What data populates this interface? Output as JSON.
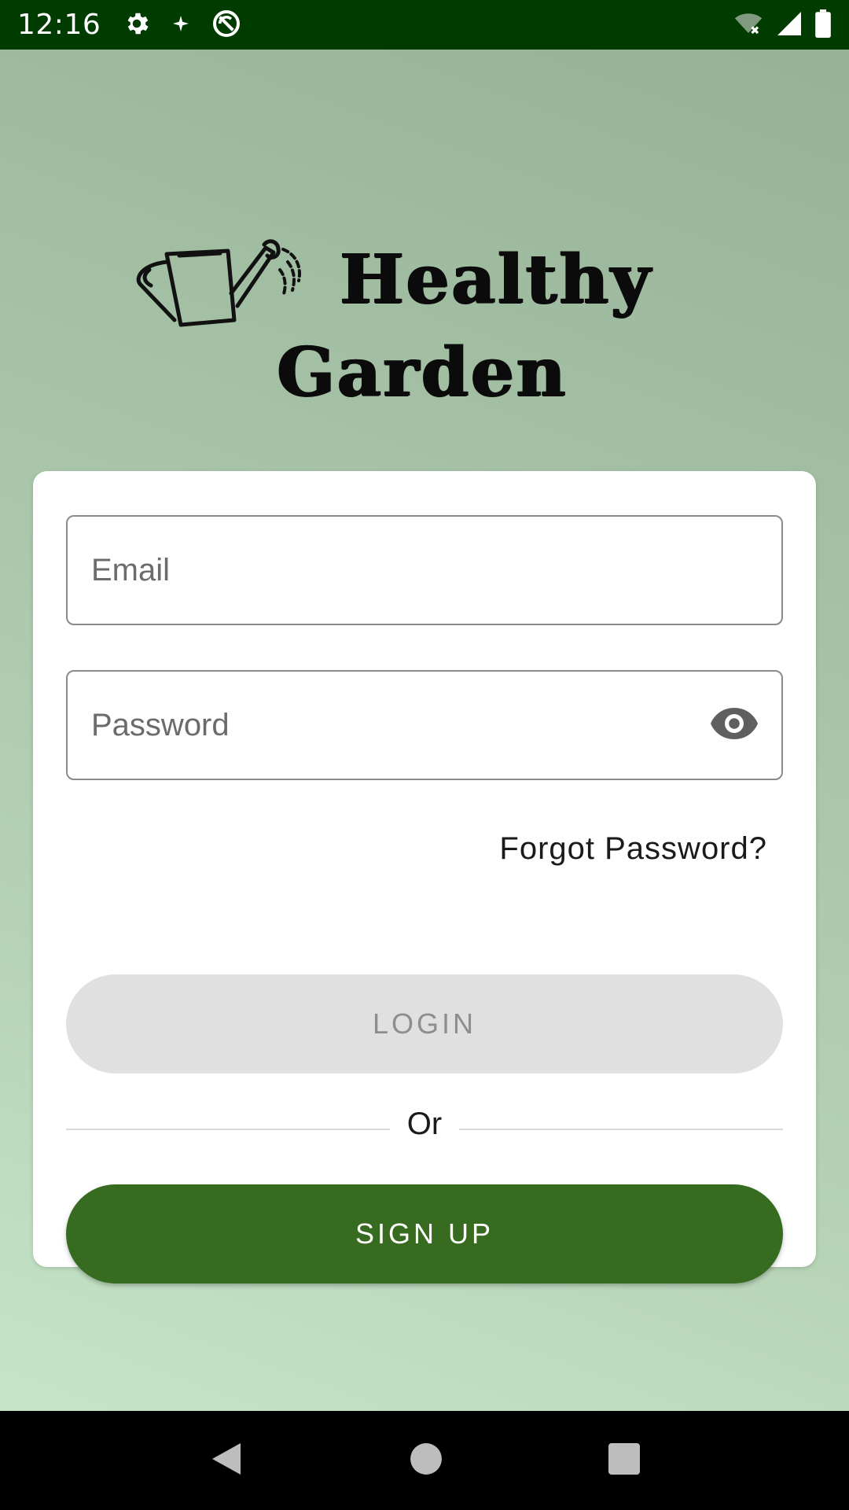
{
  "status_bar": {
    "time": "12:16",
    "icons": [
      "settings-icon",
      "sparkle-icon",
      "no-sync-icon",
      "wifi-off-icon",
      "signal-icon",
      "battery-icon"
    ]
  },
  "logo": {
    "line1": "Healthy",
    "line2": "Garden",
    "icon": "watering-can-icon"
  },
  "login_form": {
    "email_placeholder": "Email",
    "password_placeholder": "Password",
    "forgot_password": "Forgot Password?",
    "login_label": "LOGIN",
    "or_label": "Or",
    "signup_label": "SIGN UP"
  },
  "colors": {
    "status_bar": "#003b00",
    "primary": "#376b20",
    "login_disabled_bg": "#e0e0e0",
    "login_disabled_text": "#8e8e8e",
    "background_top": "#96b296",
    "background_bottom": "#c6e5c8"
  },
  "nav_bar": {
    "icons": [
      "back-icon",
      "home-icon",
      "recents-icon"
    ]
  }
}
